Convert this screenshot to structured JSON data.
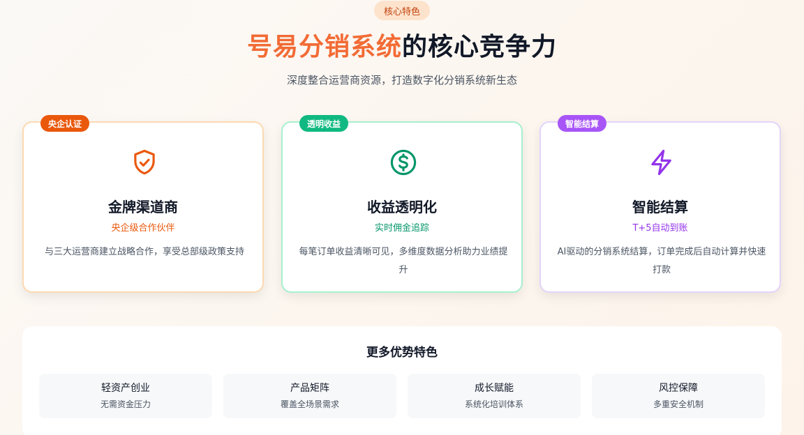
{
  "header": {
    "pill_label": "核心特色",
    "headline_accent": "号易分销系统",
    "headline_rest": "的核心竞争力",
    "subhead": "深度整合运营商资源，打造数字化分销系统新生态"
  },
  "cards": [
    {
      "badge": "央企认证",
      "icon": "shield-check-icon",
      "title": "金牌渠道商",
      "tag": "央企级合作伙伴",
      "description": "与三大运营商建立战略合作，享受总部级政策支持"
    },
    {
      "badge": "透明收益",
      "icon": "dollar-circle-icon",
      "title": "收益透明化",
      "tag": "实时佣金追踪",
      "description": "每笔订单收益清晰可见，多维度数据分析助力业绩提升"
    },
    {
      "badge": "智能结算",
      "icon": "lightning-icon",
      "title": "智能结算",
      "tag": "T+5自动到账",
      "description": "AI驱动的分销系统结算，订单完成后自动计算并快速打款"
    }
  ],
  "more": {
    "title": "更多优势特色",
    "features": [
      {
        "title": "轻资产创业",
        "subtitle": "无需资金压力"
      },
      {
        "title": "产品矩阵",
        "subtitle": "覆盖全场景需求"
      },
      {
        "title": "成长赋能",
        "subtitle": "系统化培训体系"
      },
      {
        "title": "风控保障",
        "subtitle": "多重安全机制"
      }
    ]
  },
  "colors": {
    "orange": "#ea580c",
    "green": "#059669",
    "purple": "#9333ea"
  }
}
